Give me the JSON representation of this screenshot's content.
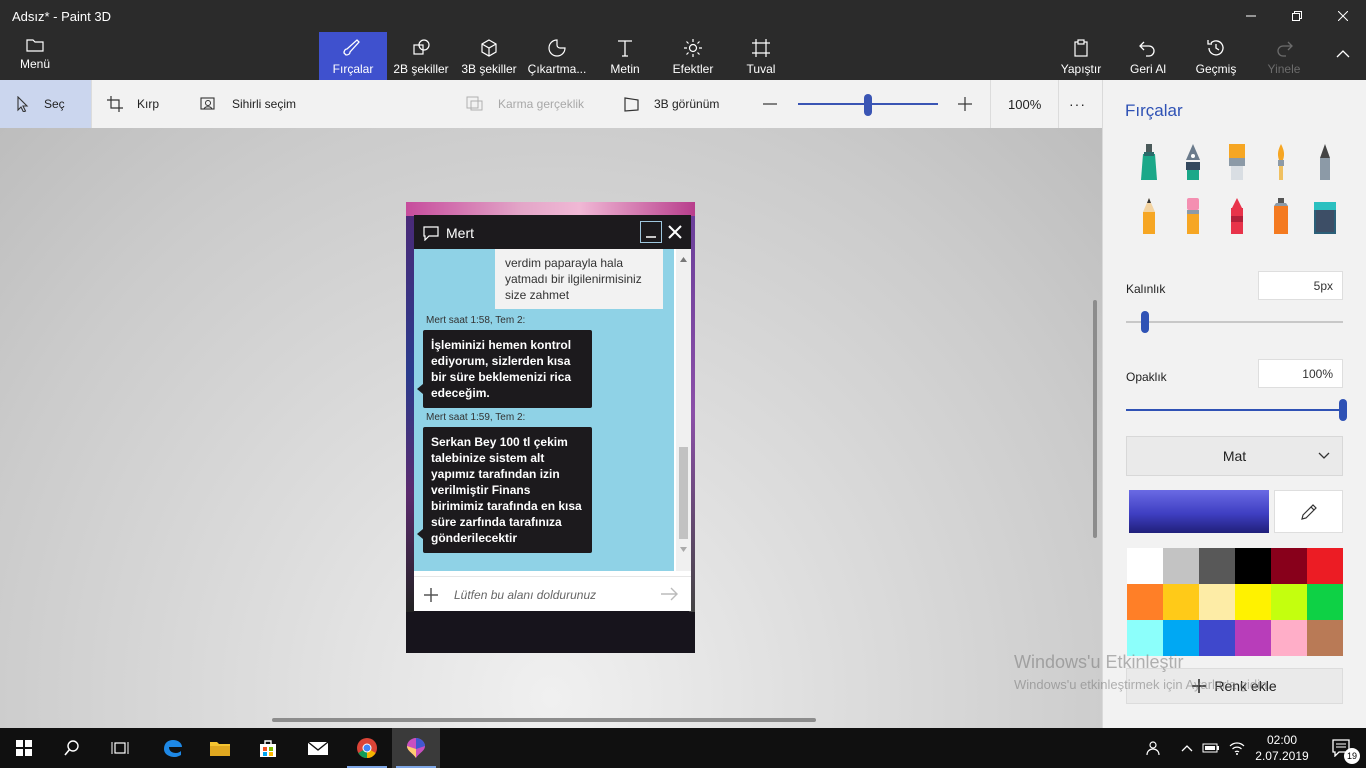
{
  "window": {
    "title": "Adsız* - Paint 3D"
  },
  "menu": {
    "label": "Menü"
  },
  "tools": [
    {
      "label": "Fırçalar"
    },
    {
      "label": "2B şekiller"
    },
    {
      "label": "3B şekiller"
    },
    {
      "label": "Çıkartma..."
    },
    {
      "label": "Metin"
    },
    {
      "label": "Efektler"
    },
    {
      "label": "Tuval"
    }
  ],
  "actions": [
    {
      "label": "Yapıştır"
    },
    {
      "label": "Geri Al"
    },
    {
      "label": "Geçmiş"
    },
    {
      "label": "Yinele"
    }
  ],
  "subtoolbar": {
    "select": "Seç",
    "crop": "Kırp",
    "magic_select": "Sihirli seçim",
    "mixed_reality": "Karma gerçeklik",
    "view3d": "3B görünüm",
    "zoom": "100%",
    "zoom_level": 0.5,
    "more": "···"
  },
  "chat": {
    "agent_name": "Mert",
    "incoming_text": "verdim paparayla hala yatmadı bir ilgilenirmisiniz size zahmet",
    "messages": [
      {
        "meta": "Mert saat 1:58, Tem 2:",
        "text": "İşleminizi hemen kontrol ediyorum, sizlerden kısa bir süre beklemenizi rica edeceğim."
      },
      {
        "meta": "Mert saat 1:59, Tem 2:",
        "text": "Serkan Bey 100 tl çekim talebinize sistem alt yapımız tarafından izin verilmiştir Finans birimimiz tarafında en kısa süre zarfında tarafınıza gönderilecektir"
      }
    ],
    "input_placeholder": "Lütfen bu alanı doldurunuz"
  },
  "panel": {
    "title": "Fırçalar",
    "brushes": [
      "marker-icon",
      "calligraphy-pen-icon",
      "oil-brush-icon",
      "watercolor-icon",
      "pixel-pen-icon",
      "pencil-icon",
      "eraser-icon",
      "crayon-icon",
      "spray-can-icon",
      "fill-icon"
    ],
    "thickness_label": "Kalınlık",
    "thickness_value": "5px",
    "thickness_level": 0.05,
    "opacity_label": "Opaklık",
    "opacity_value": "100%",
    "opacity_level": 1.0,
    "finish": "Mat",
    "current_color": "#3f3fc2",
    "palette": [
      "#ffffff",
      "#c3c3c3",
      "#585858",
      "#000000",
      "#88001b",
      "#ec1c24",
      "#ff7f27",
      "#ffca18",
      "#fdeca6",
      "#fff200",
      "#c4ff0e",
      "#0ed145",
      "#8cfffb",
      "#00a8f3",
      "#3f48cc",
      "#b83dba",
      "#ffaec8",
      "#b97a56"
    ],
    "add_color": "Renk ekle"
  },
  "watermark": {
    "line1": "Windows'u Etkinleştir",
    "line2": "Windows'u etkinleştirmek için Ayarlar'a gidin."
  },
  "taskbar": {
    "time": "02:00",
    "date": "2.07.2019",
    "notifications": "19"
  }
}
